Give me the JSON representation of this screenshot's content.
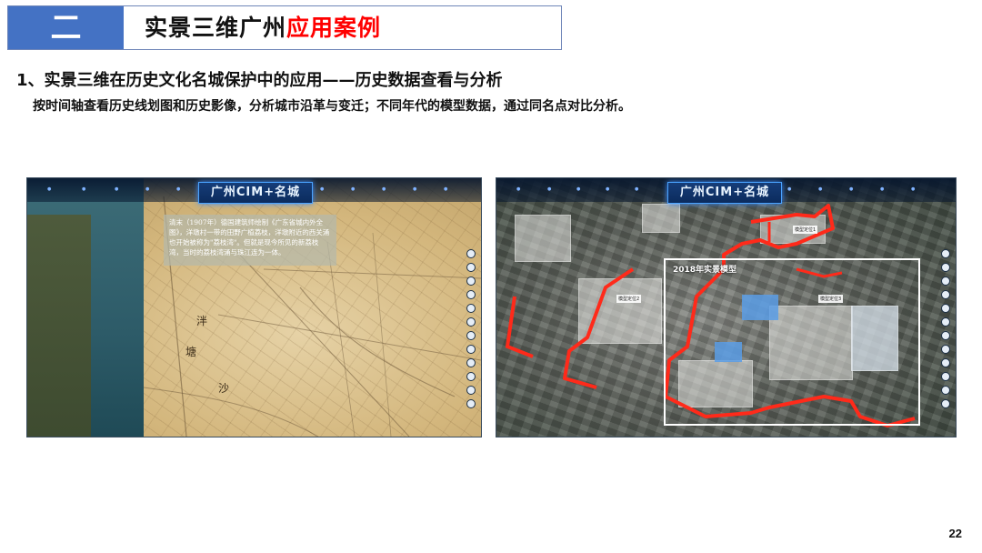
{
  "header": {
    "section_num": "二",
    "title_main": "实景三维广州",
    "title_highlight": "应用案例"
  },
  "subheading": "1、实景三维在历史文化名城保护中的应用——历史数据查看与分析",
  "description": "按时间轴查看历史线划图和历史影像，分析城市沿革与变迁；不同年代的模型数据，通过同名点对比分析。",
  "page_number": "22",
  "screenshots": {
    "left": {
      "app_title": "广州CIM+名城",
      "annotation": "清末（1907年）德国建筑师绘制《广东省城内外全图》，洋墩村一带的田野广植荔枝，洋墩附近的西关涌也开始被称为\"荔枝湾\"。但就是现今所见的新荔枝湾，当时的荔枝湾涌与珠江连为一体。",
      "map_labels": [
        "泮",
        "塘",
        "沙"
      ]
    },
    "right": {
      "app_title": "广州CIM+名城",
      "model_label": "2018年实景模型",
      "tags": [
        "模型定位1",
        "模型定位2",
        "模型定位3"
      ]
    }
  },
  "colors": {
    "header_blue": "#4472c4",
    "highlight_red": "#ff0000",
    "boundary_red": "#ff2a1a"
  }
}
